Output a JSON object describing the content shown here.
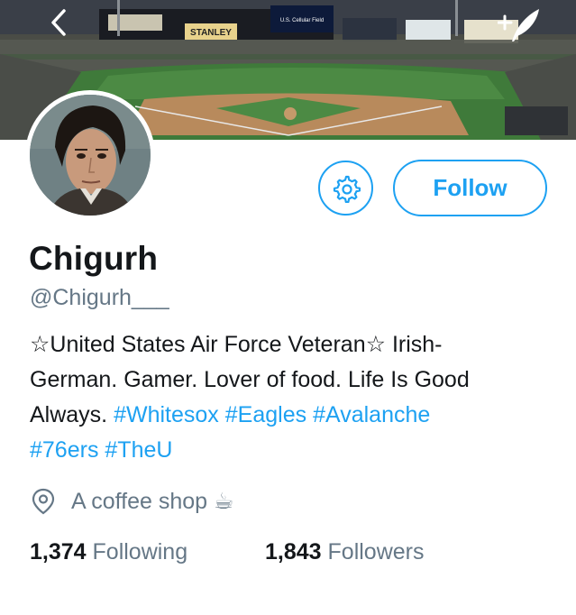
{
  "header": {
    "back_icon": "chevron-left-icon",
    "compose_icon": "compose-tweet-icon",
    "banner_description": "baseball stadium banner"
  },
  "stadium_signs": {
    "sign_1": "STANLEY",
    "sign_2": "U.S. Cellular Field"
  },
  "profile": {
    "name": "Chigurh",
    "handle": "@Chigurh___",
    "settings_icon": "gear-icon",
    "follow_label": "Follow"
  },
  "bio": {
    "line1": "☆United States Air Force Veteran☆ Irish-",
    "line2": "German. Gamer. Lover of food. Life Is Good",
    "line3_text": "Always. ",
    "hashtags": [
      "#Whitesox",
      "#Eagles",
      "#Avalanche",
      "#76ers",
      "#TheU"
    ]
  },
  "location": {
    "icon": "location-pin-icon",
    "text": "A coffee shop ☕"
  },
  "stats": {
    "following_count": "1,374",
    "following_label": "Following",
    "followers_count": "1,843",
    "followers_label": "Followers"
  },
  "colors": {
    "accent": "#1da1f2",
    "text_primary": "#14171a",
    "text_secondary": "#657786"
  }
}
